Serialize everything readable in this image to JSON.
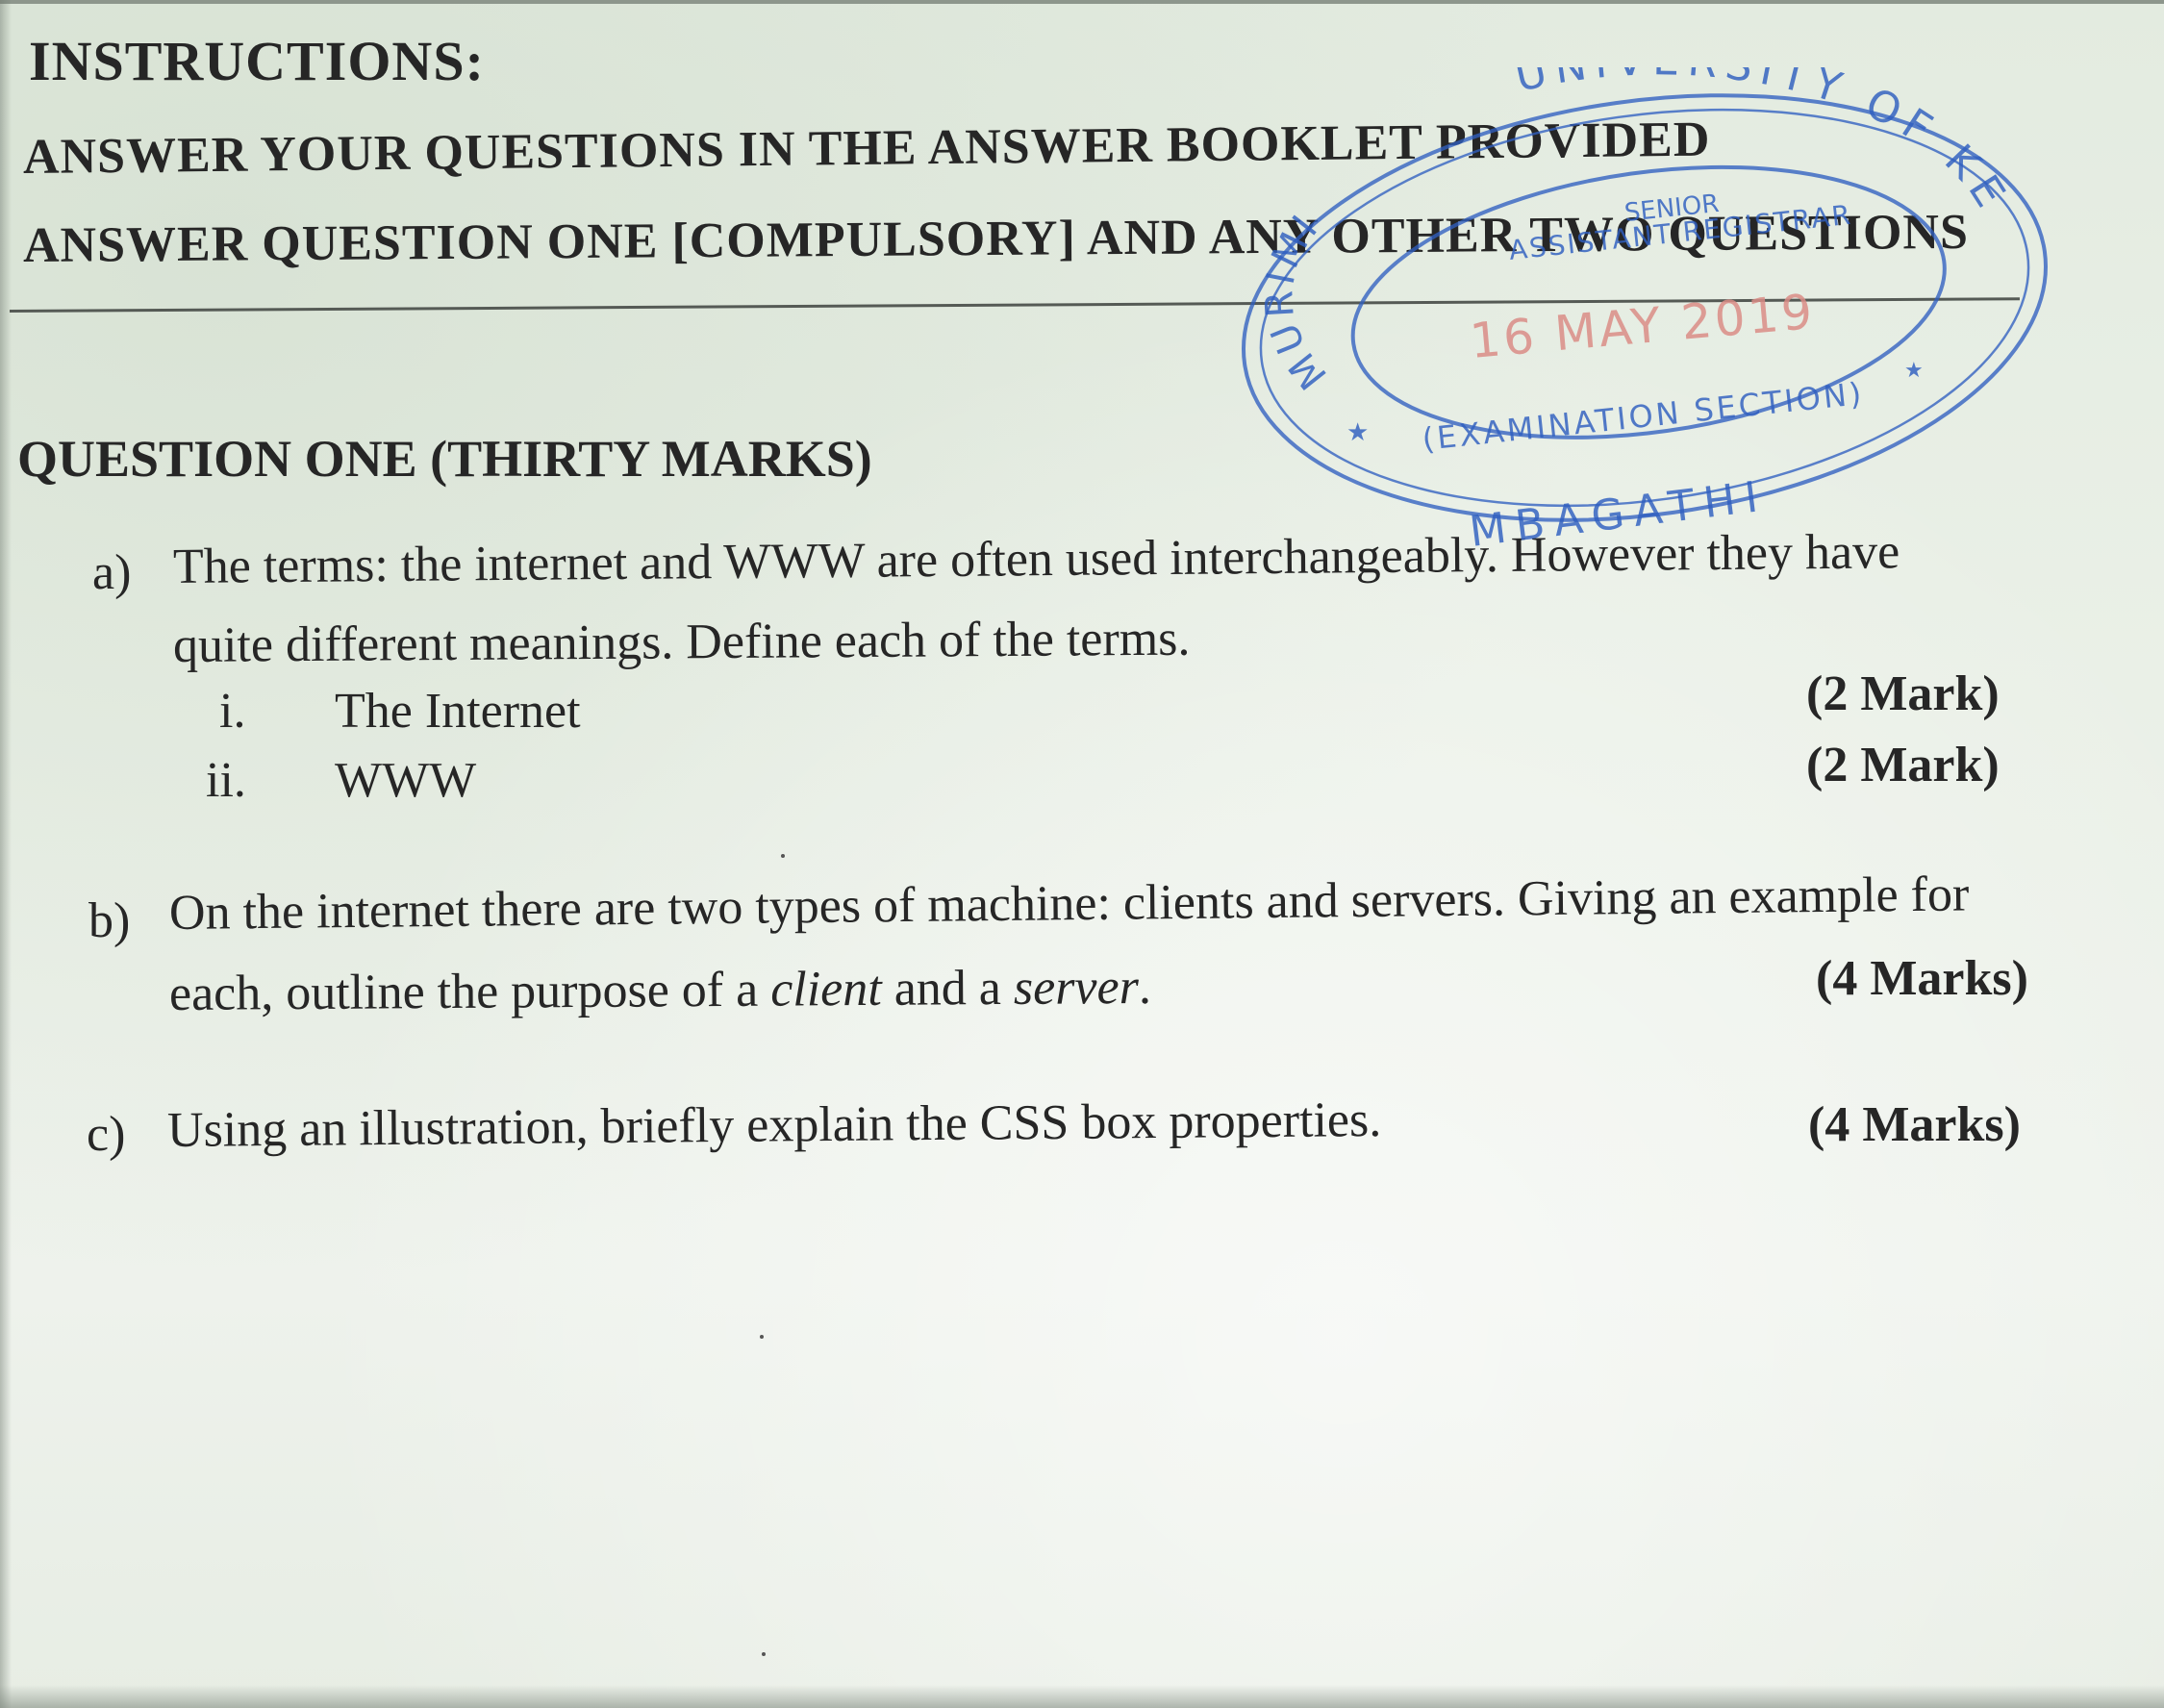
{
  "instructions": {
    "title": "INSTRUCTIONS:",
    "line1": "ANSWER YOUR QUESTIONS IN THE ANSWER BOOKLET PROVIDED",
    "line2": "ANSWER QUESTION ONE [COMPULSORY] AND ANY OTHER TWO QUESTIONS"
  },
  "question_one": {
    "title": "QUESTION ONE (THIRTY MARKS)",
    "part_a": {
      "label": "a)",
      "line1": "The terms: the internet and WWW are often used interchangeably. However they have",
      "line2": "quite different meanings. Define each of the terms.",
      "subparts": [
        {
          "label": "i.",
          "text": "The Internet",
          "marks": "(2 Mark)"
        },
        {
          "label": "ii.",
          "text": "WWW",
          "marks": "(2 Mark)"
        }
      ]
    },
    "part_b": {
      "label": "b)",
      "line1": "On the internet there are two types of machine: clients and servers. Giving an example for",
      "line2_start": "each, outline the purpose of a ",
      "line2_em1": "client",
      "line2_mid": " and a ",
      "line2_em2": "server",
      "line2_end": ".",
      "marks": "(4 Marks)"
    },
    "part_c": {
      "label": "c)",
      "text": "Using an illustration, briefly explain the CSS box properties.",
      "marks": "(4 Marks)"
    }
  },
  "stamp": {
    "color": "#2f5fc0",
    "date_color": "#d98c86",
    "top_arc": "UNIVERSITY OF KENYA",
    "left_arc": "MURIMI",
    "line1": "SENIOR",
    "line2": "ASSISTANT REGISTRAR",
    "date": "16 MAY 2019",
    "section": "(EXAMINATION SECTION)",
    "bottom": "MBAGATHI"
  }
}
